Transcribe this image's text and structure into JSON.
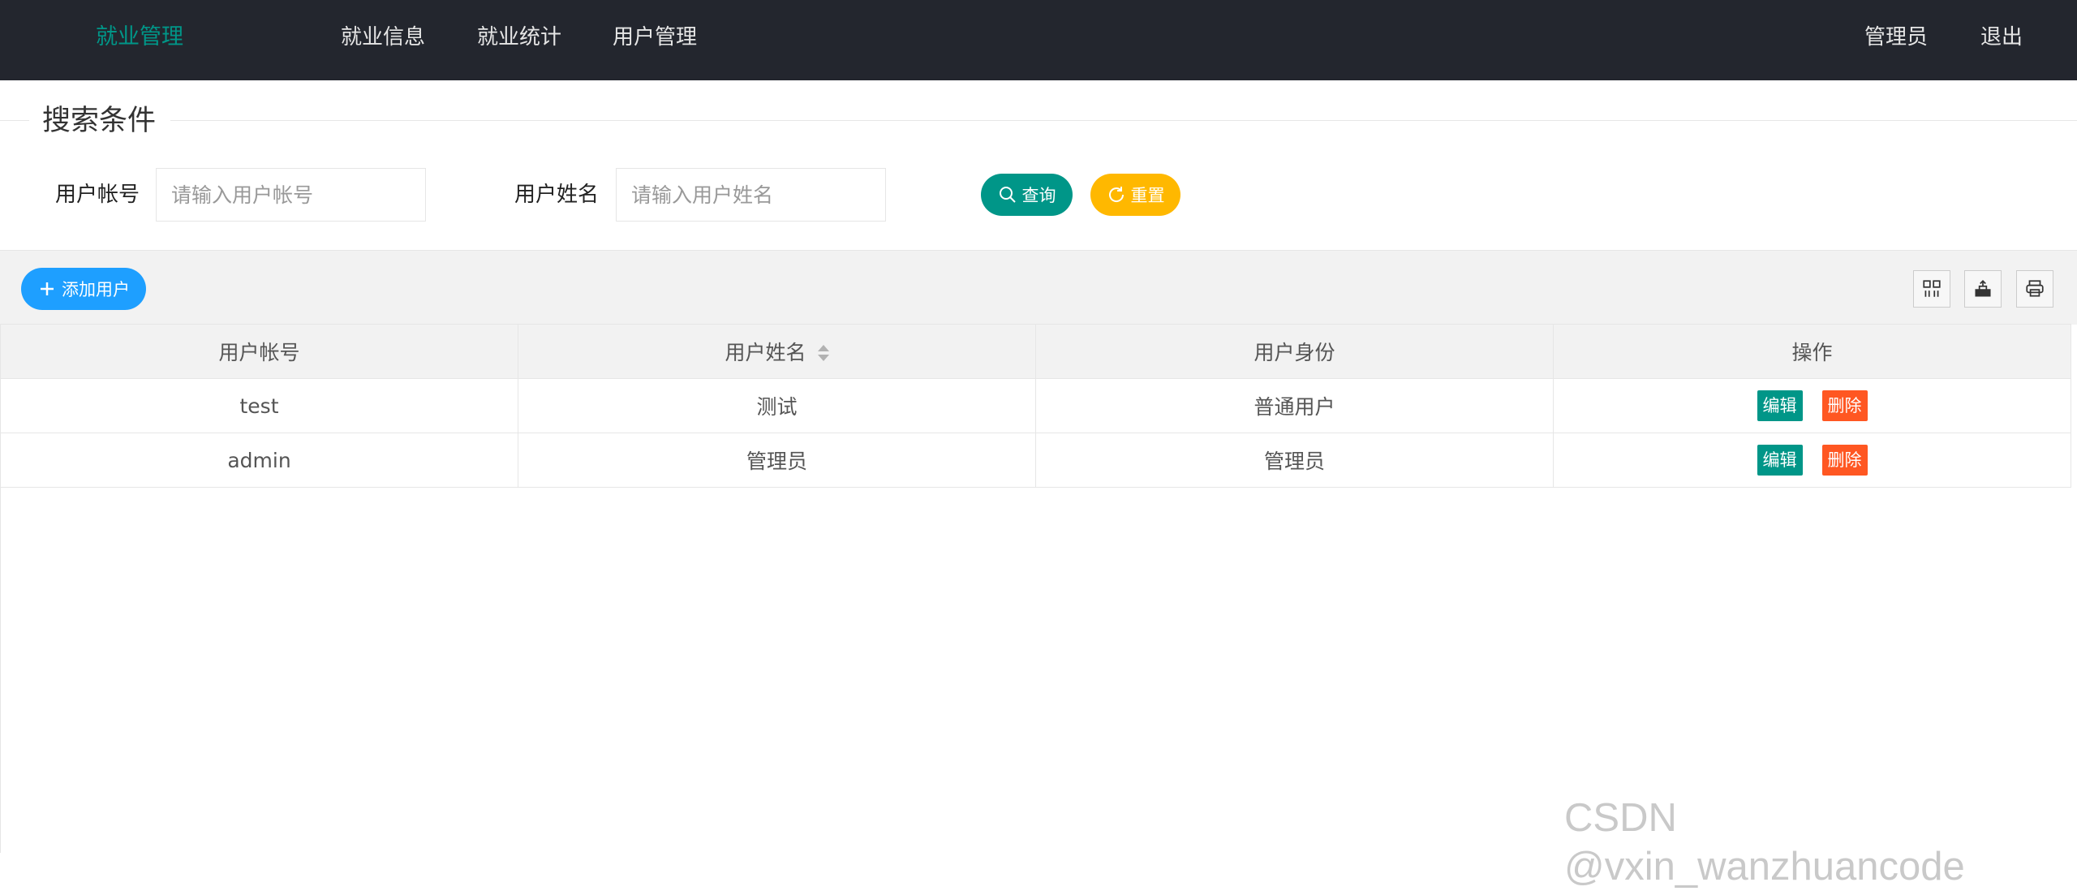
{
  "header": {
    "brand": "就业管理",
    "nav": [
      "就业信息",
      "就业统计",
      "用户管理"
    ],
    "user": "管理员",
    "logout": "退出"
  },
  "search": {
    "legend": "搜索条件",
    "account_label": "用户帐号",
    "account_placeholder": "请输入用户帐号",
    "account_value": "",
    "name_label": "用户姓名",
    "name_placeholder": "请输入用户姓名",
    "name_value": "",
    "query_label": "查询",
    "reset_label": "重置"
  },
  "toolbar": {
    "add_label": "添加用户",
    "icons": [
      "columns-icon",
      "export-icon",
      "print-icon"
    ]
  },
  "table": {
    "headers": [
      "用户帐号",
      "用户姓名",
      "用户身份",
      "操作"
    ],
    "rows": [
      {
        "account": "test",
        "name": "测试",
        "role": "普通用户"
      },
      {
        "account": "admin",
        "name": "管理员",
        "role": "管理员"
      }
    ],
    "edit_label": "编辑",
    "delete_label": "删除"
  },
  "watermark": "CSDN @vxin_wanzhuancode",
  "colors": {
    "topbar": "#23262e",
    "brand": "#009688",
    "query": "#009688",
    "reset": "#ffb800",
    "add": "#1e9fff",
    "edit": "#009688",
    "delete": "#ff5722"
  }
}
